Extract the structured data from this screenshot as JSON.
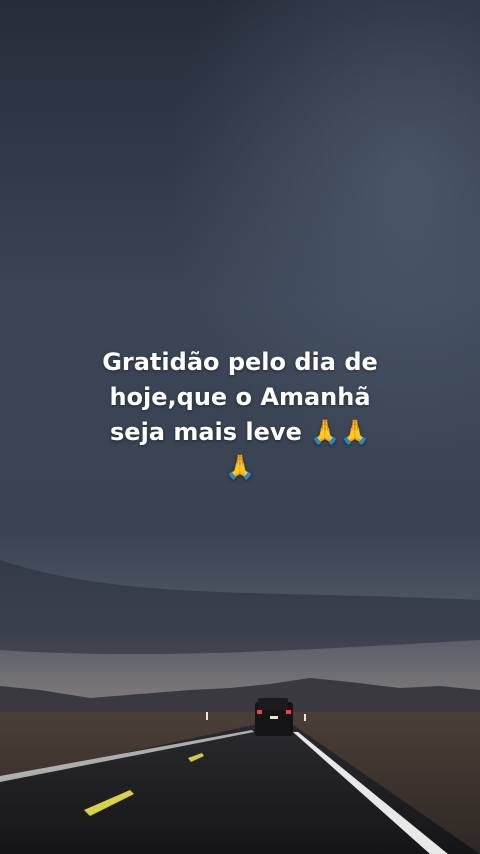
{
  "caption": {
    "text": "Gratidão pelo dia de\nhoje,que o Amanhã\nseja mais  leve 🙏🙏\n🙏"
  },
  "colors": {
    "sky_top": "#272c39",
    "sky_mid": "#3c4658",
    "horizon": "#6d6f78",
    "mountains": "#3b3b44",
    "desert": "#5a4a3f",
    "road": "#1c1c20",
    "lane_yellow": "#d8d24a",
    "lane_white": "#e8e8e8"
  }
}
